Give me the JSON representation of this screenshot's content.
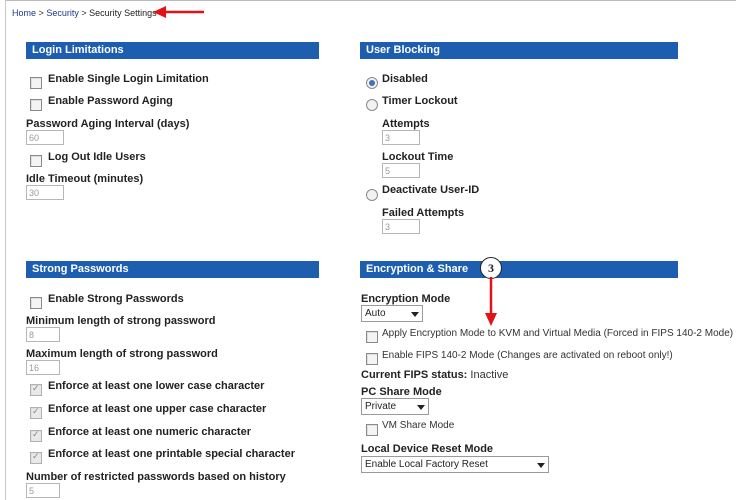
{
  "breadcrumb": {
    "home": "Home",
    "security": "Security",
    "current": "Security Settings",
    "separator": ">"
  },
  "login_limitations": {
    "title": "Login Limitations",
    "single_login": "Enable Single Login Limitation",
    "password_aging": "Enable Password Aging",
    "aging_interval_label": "Password Aging Interval (days)",
    "aging_interval_value": "60",
    "logout_idle": "Log Out Idle Users",
    "idle_timeout_label": "Idle Timeout (minutes)",
    "idle_timeout_value": "30"
  },
  "user_blocking": {
    "title": "User Blocking",
    "disabled": "Disabled",
    "timer_lockout": "Timer Lockout",
    "attempts_label": "Attempts",
    "attempts_value": "3",
    "lockout_time_label": "Lockout Time",
    "lockout_time_value": "5",
    "deactivate": "Deactivate User-ID",
    "failed_attempts_label": "Failed Attempts",
    "failed_attempts_value": "3",
    "selected": "disabled"
  },
  "strong_passwords": {
    "title": "Strong Passwords",
    "enable": "Enable Strong Passwords",
    "min_length_label": "Minimum length of strong password",
    "min_length_value": "8",
    "max_length_label": "Maximum length of strong password",
    "max_length_value": "16",
    "lower": "Enforce at least one lower case character",
    "upper": "Enforce at least one upper case character",
    "numeric": "Enforce at least one numeric character",
    "special": "Enforce at least one printable special character",
    "history_label": "Number of restricted passwords based on history",
    "history_value": "5"
  },
  "encryption_share": {
    "title": "Encryption & Share",
    "mode_label": "Encryption Mode",
    "mode_value": "Auto",
    "apply_kvm": "Apply Encryption Mode to KVM and Virtual Media (Forced in FIPS 140-2 Mode)",
    "enable_fips": "Enable FIPS 140-2 Mode (Changes are activated on reboot only!)",
    "fips_status_label": "Current FIPS status:",
    "fips_status_value": "Inactive",
    "pc_share_label": "PC Share Mode",
    "pc_share_value": "Private",
    "vm_share": "VM Share Mode",
    "reset_label": "Local Device Reset Mode",
    "reset_value": "Enable Local Factory Reset"
  },
  "annotations": {
    "callout_number": "3",
    "arrow_color": "#e0131b"
  },
  "colors": {
    "section_bar": "#1d5eb1",
    "link": "#1a3c8c"
  }
}
